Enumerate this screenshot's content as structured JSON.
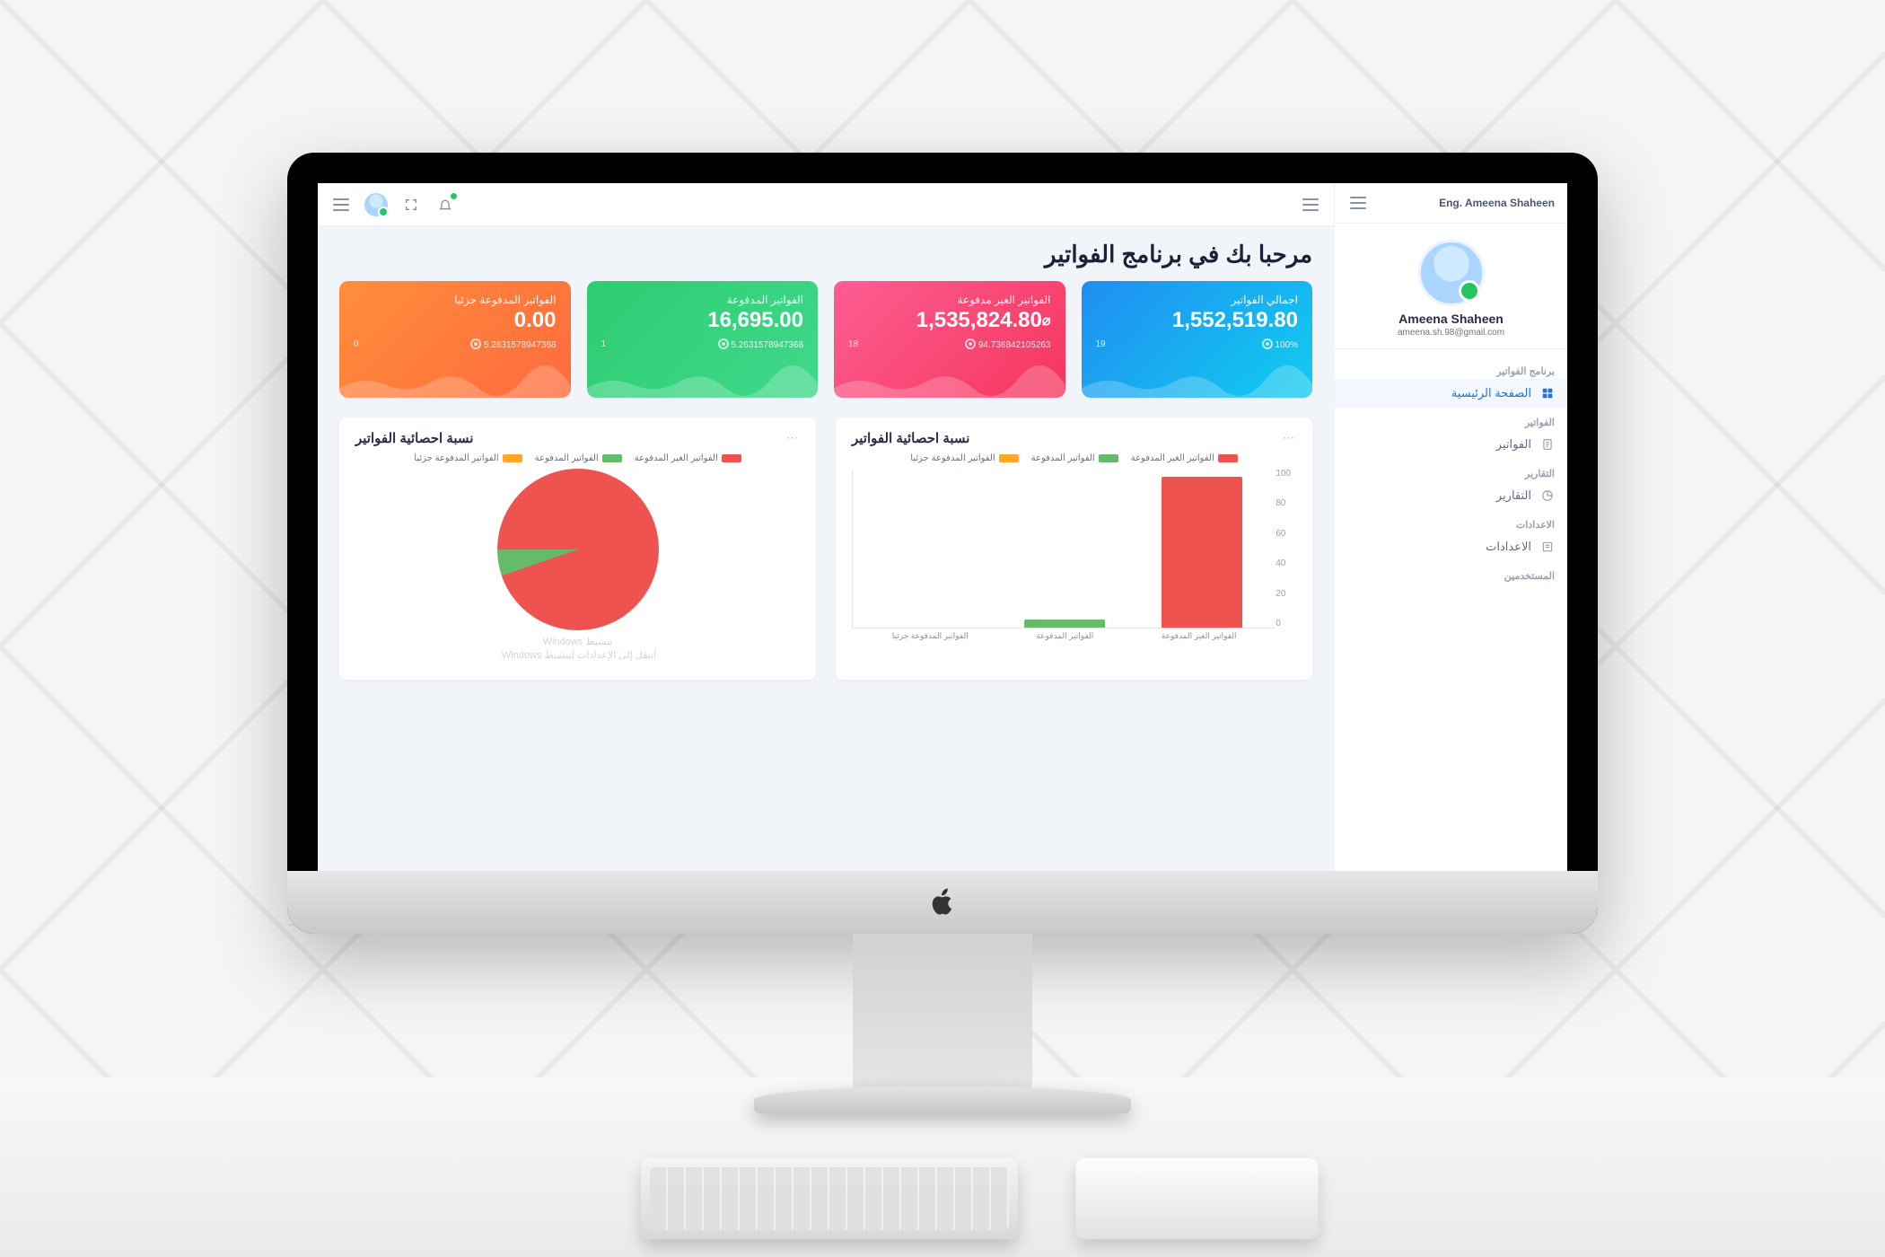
{
  "header": {
    "user_label": "Eng. Ameena Shaheen"
  },
  "profile": {
    "name": "Ameena Shaheen",
    "email": "ameena.sh.98@gmail.com"
  },
  "sidebar": {
    "groups": [
      {
        "title": "برنامج الفواتير",
        "items": [
          {
            "label": "الصفحة الرئيسية",
            "icon": "grid-icon",
            "active": true
          }
        ]
      },
      {
        "title": "الفواتير",
        "items": [
          {
            "label": "الفواتير",
            "icon": "invoice-icon",
            "active": false
          }
        ]
      },
      {
        "title": "التقارير",
        "items": [
          {
            "label": "التقارير",
            "icon": "report-icon",
            "active": false
          }
        ]
      },
      {
        "title": "الاعدادات",
        "items": [
          {
            "label": "الاعدادات",
            "icon": "settings-icon",
            "active": false
          }
        ]
      },
      {
        "title": "المستخدمين",
        "items": []
      }
    ]
  },
  "page": {
    "title": "مرحبا بك في برنامج الفواتير"
  },
  "cards": [
    {
      "theme": "c-blue",
      "label": "اجمالي الفواتير",
      "value": "1,552,519.80",
      "count": "19",
      "pct": "100%",
      "detail": ""
    },
    {
      "theme": "c-pink",
      "label": "الفواتير الغير مدفوعة",
      "value": "1,535,824.80",
      "count": "18",
      "pct": "",
      "detail": "94.736842105263"
    },
    {
      "theme": "c-green",
      "label": "الفواتير المدفوعة",
      "value": "16,695.00",
      "count": "1",
      "pct": "",
      "detail": "5.2631578947368"
    },
    {
      "theme": "c-orange",
      "label": "الفواتير المدفوعة جزئيا",
      "value": "0.00",
      "count": "0",
      "pct": "",
      "detail": "5.2631578947368"
    }
  ],
  "panels": {
    "bar": {
      "title": "نسبة احصائية الفواتير",
      "legend": [
        "الفواتير الغير المدفوعة",
        "الفواتير المدفوعة",
        "الفواتير المدفوعة جزئيا"
      ]
    },
    "pie": {
      "title": "نسبة احصائية الفواتير",
      "legend": [
        "الفواتير الغير المدفوعة",
        "الفواتير المدفوعة",
        "الفواتير المدفوعة جزئيا"
      ]
    }
  },
  "footer": {
    "line1": "تنشيط Windows",
    "line2": "انتقل إلى الإعدادات لتنشيط Windows."
  },
  "chart_data": [
    {
      "type": "bar",
      "title": "نسبة احصائية الفواتير",
      "categories": [
        "الفواتير الغير المدفوعة",
        "الفواتير المدفوعة",
        "الفواتير المدفوعة جزئيا"
      ],
      "series": [
        {
          "name": "percent",
          "values": [
            94.74,
            5.26,
            0
          ]
        }
      ],
      "colors": [
        "#ef5350",
        "#66bb6a",
        "#ffa726"
      ],
      "ylabel": "",
      "xlabel": "",
      "yticks": [
        0,
        20,
        40,
        60,
        80,
        100
      ],
      "ylim": [
        0,
        100
      ]
    },
    {
      "type": "pie",
      "title": "نسبة احصائية الفواتير",
      "categories": [
        "الفواتير الغير المدفوعة",
        "الفواتير المدفوعة",
        "الفواتير المدفوعة جزئيا"
      ],
      "values": [
        94.74,
        5.26,
        0
      ],
      "colors": [
        "#ef5350",
        "#66bb6a",
        "#ffa726"
      ]
    }
  ],
  "colors": {
    "accent": "#1f6feb",
    "orange": "#ff7a3d",
    "green": "#2ecc71",
    "pink": "#f5365c",
    "blue": "#1f8ef1",
    "red": "#ef5350",
    "lime": "#66bb6a",
    "amber": "#ffa726"
  }
}
